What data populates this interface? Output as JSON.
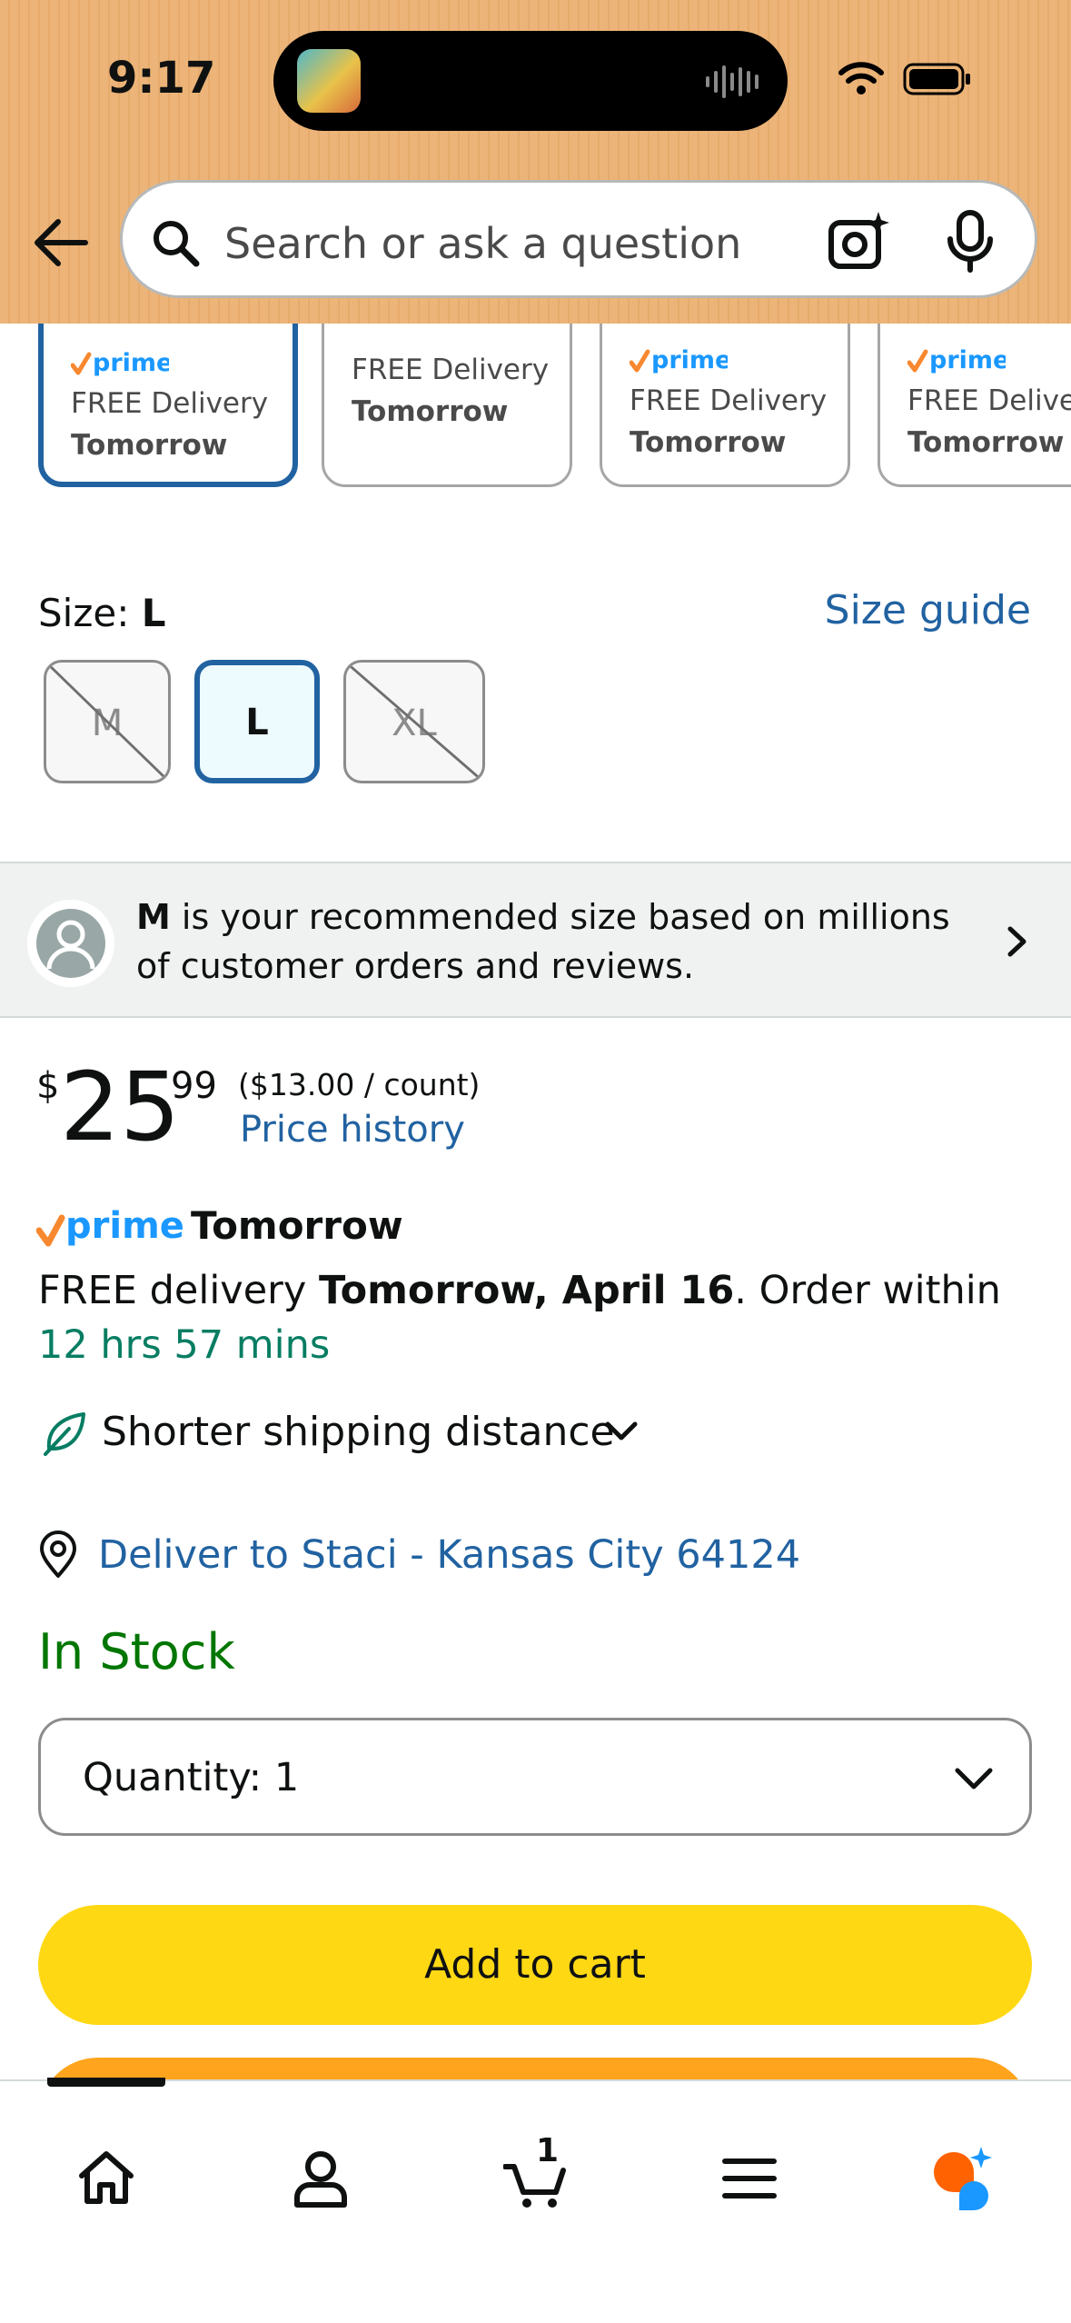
{
  "status_bar": {
    "time": "9:17"
  },
  "search": {
    "placeholder": "Search or ask a question"
  },
  "delivery_cards": [
    {
      "prime": true,
      "free": "FREE Delivery",
      "when": "Tomorrow",
      "selected": true
    },
    {
      "prime": false,
      "free": "FREE Delivery",
      "when": "Tomorrow",
      "selected": false
    },
    {
      "prime": true,
      "free": "FREE Delivery",
      "when": "Tomorrow",
      "selected": false
    },
    {
      "prime": true,
      "free": "FREE Delivery",
      "when": "Tomorrow",
      "selected": false
    }
  ],
  "size": {
    "label": "Size: ",
    "selected": "L",
    "guide_label": "Size guide",
    "options": [
      {
        "label": "M",
        "available": false
      },
      {
        "label": "L",
        "available": true,
        "selected": true
      },
      {
        "label": "XL",
        "available": false
      }
    ]
  },
  "recommendation": {
    "size": "M",
    "text": " is your recommended size based on millions of customer orders and reviews."
  },
  "price": {
    "symbol": "$",
    "whole": "25",
    "fraction": "99",
    "unit": "($13.00 / count)",
    "history_label": "Price history"
  },
  "prime_delivery": {
    "prime_word": "prime",
    "headline": "Tomorrow",
    "line_prefix": "FREE delivery ",
    "line_date": "Tomorrow, April 16",
    "line_middle": ". Order within ",
    "line_countdown": "12 hrs 57 mins"
  },
  "shipping": {
    "label": "Shorter shipping distance"
  },
  "deliver_to": {
    "label": "Deliver to Staci - Kansas City 64124"
  },
  "stock": {
    "label": "In Stock"
  },
  "quantity": {
    "label": "Quantity:",
    "value": "1"
  },
  "buttons": {
    "add_to_cart": "Add to cart"
  },
  "bottom_nav": {
    "cart_count": "1"
  },
  "colors": {
    "link": "#2162a1",
    "in_stock": "#007600",
    "countdown": "#067d62",
    "add_to_cart": "#ffd814",
    "buy_now": "#ffa41c",
    "header": "#ecb478",
    "prime_blue": "#1a98ff",
    "prime_check": "#f7882f"
  }
}
